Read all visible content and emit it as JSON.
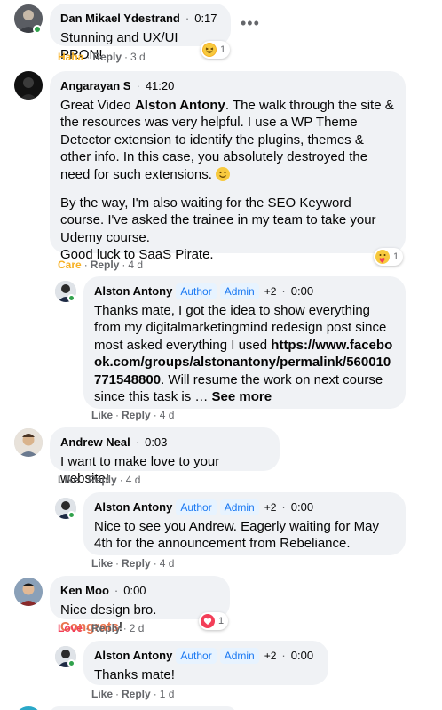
{
  "comments": [
    {
      "author": "Dan Mikael Ydestrand",
      "time": "0:17",
      "text": "Stunning and UX/UI PRON!",
      "reaction_label": "Haha",
      "reply_label": "Reply",
      "age": "3 d",
      "react_count": "1",
      "more_icon": "more-dots-icon"
    },
    {
      "author": "Angarayan S",
      "time": "41:20",
      "text_p1_a": "Great Video ",
      "text_p1_bold": "Alston Antony",
      "text_p1_b": ". The walk through the site & the resources was very helpful. I use a WP Theme Detector extension to identify the plugins, themes & other info. In this case, you absolutely destroyed the need for such extensions. ",
      "text_p2": "By the way, I'm also waiting for the SEO Keyword course. I've asked the trainee in my team to take your Udemy course.",
      "text_p3": "Good luck to SaaS Pirate.",
      "reaction_label": "Care",
      "reply_label": "Reply",
      "age": "4 d",
      "react_count": "1"
    },
    {
      "author": "Alston Antony",
      "badge_author": "Author",
      "badge_admin": "Admin",
      "plus": "+2",
      "time": "0:00",
      "text_a": "Thanks mate, I got the idea to show everything from my digitalmarketingmind redesign post since most asked everything I used ",
      "link": "https://www.facebook.com/groups/alstonantony/permalink/560010771548800",
      "text_b": ". Will resume the work on next course since this task is … ",
      "see_more": "See more",
      "like_label": "Like",
      "reply_label": "Reply",
      "age": "4 d"
    },
    {
      "author": "Andrew Neal",
      "time": "0:03",
      "text": "I want to make love to your website!",
      "like_label": "Like",
      "reply_label": "Reply",
      "age": "4 d"
    },
    {
      "author": "Alston Antony",
      "badge_author": "Author",
      "badge_admin": "Admin",
      "plus": "+2",
      "time": "0:00",
      "text": "Nice to see you Andrew. Eagerly waiting for May 4th for the announcement from Rebeliance.",
      "like_label": "Like",
      "reply_label": "Reply",
      "age": "4 d"
    },
    {
      "author": "Ken Moo",
      "time": "0:00",
      "text_a": "Nice design bro. ",
      "text_hl": "Congrats",
      "text_b": "!",
      "reaction_label": "Love",
      "reply_label": "Reply",
      "age": "2 d",
      "react_count": "1"
    },
    {
      "author": "Alston Antony",
      "badge_author": "Author",
      "badge_admin": "Admin",
      "plus": "+2",
      "time": "0:00",
      "text": "Thanks mate!",
      "like_label": "Like",
      "reply_label": "Reply",
      "age": "1 d"
    }
  ],
  "separator": "·",
  "colors": {
    "bubble": "#f0f2f5",
    "online": "#31a24c",
    "haha": "#f7b125",
    "love": "#f33e58",
    "badge_bg": "#e7f3ff",
    "badge_fg": "#1877f2"
  }
}
